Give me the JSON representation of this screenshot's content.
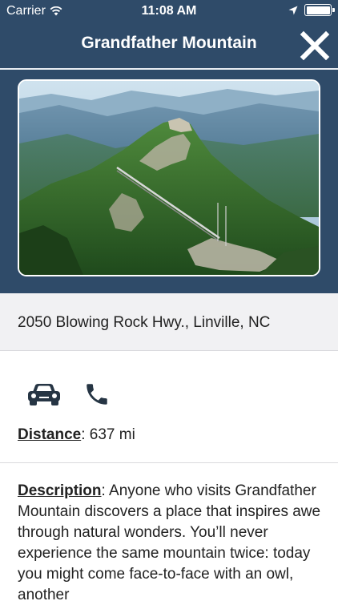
{
  "status_bar": {
    "carrier": "Carrier",
    "time": "11:08 AM",
    "battery_level": 1.0
  },
  "nav": {
    "title": "Grandfather Mountain",
    "close_icon": "close-x-icon"
  },
  "photo": {
    "subject": "mountain-peak-bridge-photo"
  },
  "address": "2050 Blowing Rock Hwy., Linville, NC",
  "actions": {
    "car_icon": "car-icon",
    "phone_icon": "phone-icon"
  },
  "distance": {
    "label": "Distance",
    "value": ": 637 mi"
  },
  "description": {
    "label": "Description",
    "text": ": Anyone who visits Grandfather Mountain discovers a place that inspires awe through natural wonders. You’ll never experience the same mountain twice: today you might come face-to-face with an owl, another"
  },
  "colors": {
    "header_bg": "#2f4b69",
    "address_bg": "#f1f1f3",
    "text": "#222222",
    "icon": "#263544"
  }
}
